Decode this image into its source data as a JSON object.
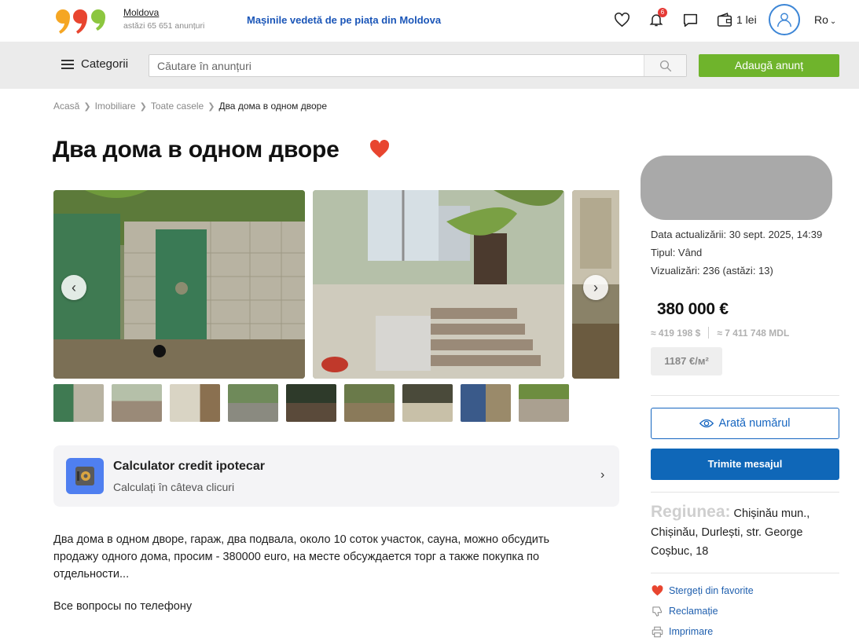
{
  "header": {
    "region_name": "Moldova",
    "region_count": "astăzi 65 651 anunțuri",
    "promo": "Mașinile vedetă de pe piața din Moldova",
    "notifications_count": "6",
    "wallet": "1 lei",
    "language": "Ro"
  },
  "searchbar": {
    "categories_label": "Categorii",
    "placeholder": "Căutare în anunțuri",
    "add_label": "Adaugă anunț"
  },
  "breadcrumb": [
    "Acasă",
    "Imobiliare",
    "Toate casele",
    "Два дома в одном дворе"
  ],
  "listing": {
    "title": "Два дома в одном дворе",
    "description": "Два дома в одном дворе, гараж, два подвала, около 10 соток участок,  сауна, можно обсудить продажу одного дома,  просим - 380000 euro, на месте обсуждается торг а также покупка по отдельности...",
    "description_2": "Все вопросы по телефону"
  },
  "calculator": {
    "title": "Calculator credit ipotecar",
    "subtitle": "Calculați în câteva clicuri"
  },
  "details": {
    "updated": "Data actualizării: 30 sept. 2025, 14:39",
    "type": "Tipul: Vând",
    "views": "Vizualizări: 236 (astăzi: 13)",
    "price": "380 000 €",
    "price_usd": "≈ 419 198 $",
    "price_mdl": "≈ 7 411 748 MDL",
    "price_per_m2": "1187 €/м²",
    "show_number": "Arată numărul",
    "send_message": "Trimite mesajul",
    "region_label": "Regiunea:",
    "region_value": "Chișinău mun., Chișinău, Durlești, str. George Coșbuc, 18",
    "remove_favorite": "Stergeți din favorite",
    "report": "Reclamație",
    "print": "Imprimare"
  },
  "colors": {
    "accent_green": "#6fb42c",
    "link_blue": "#1565c0",
    "button_blue": "#0f67b8",
    "heart_red": "#e8452f"
  }
}
